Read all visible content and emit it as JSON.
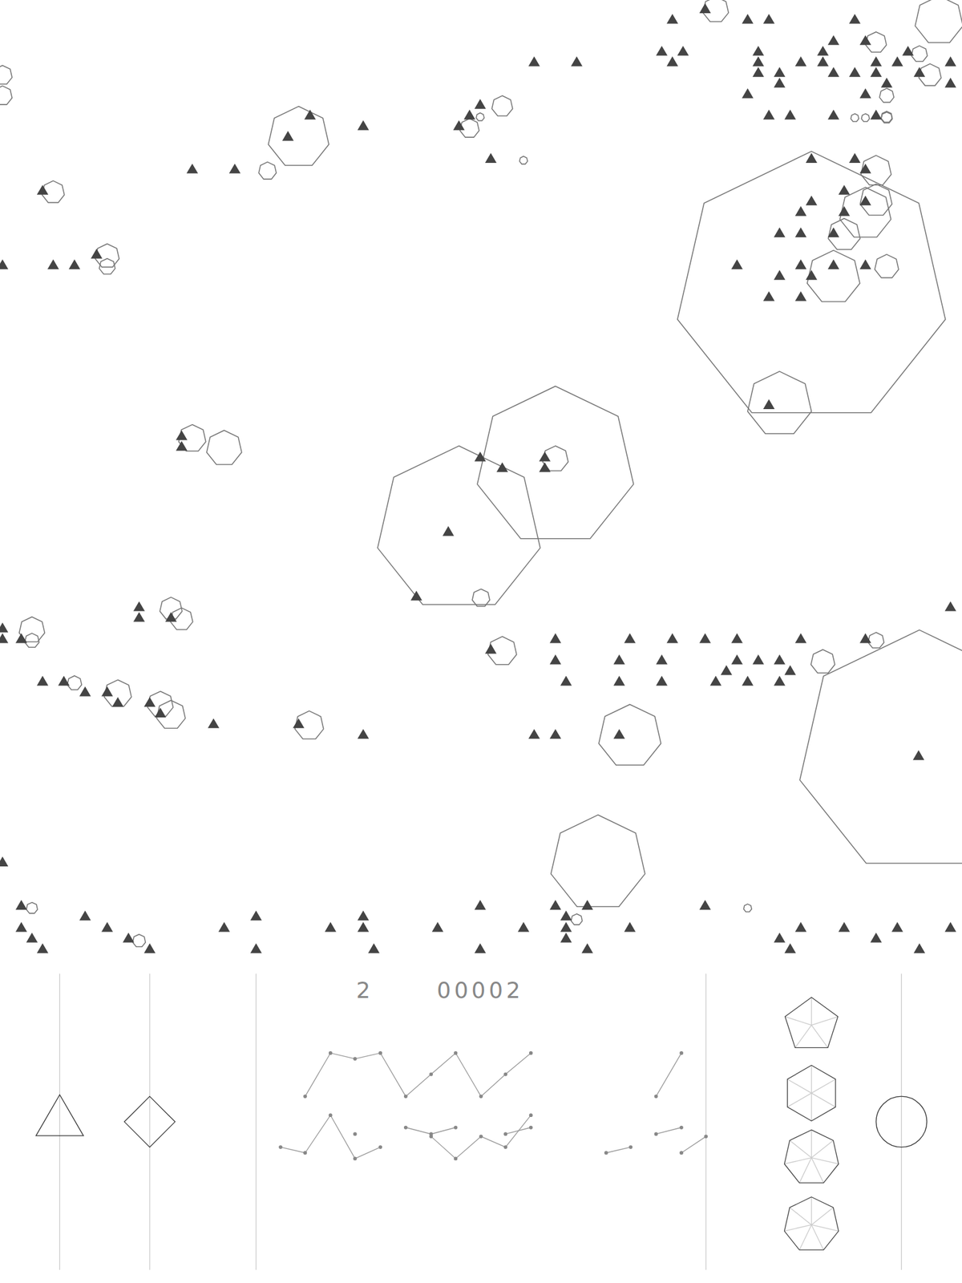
{
  "hud": {
    "lives": "2",
    "score": "00002"
  },
  "ships": [
    {
      "kind": "triangle"
    },
    {
      "kind": "diamond"
    }
  ],
  "powers": [
    {
      "kind": "pentagon"
    },
    {
      "kind": "hexagon"
    },
    {
      "kind": "heptagon"
    },
    {
      "kind": "heptagon"
    }
  ]
}
